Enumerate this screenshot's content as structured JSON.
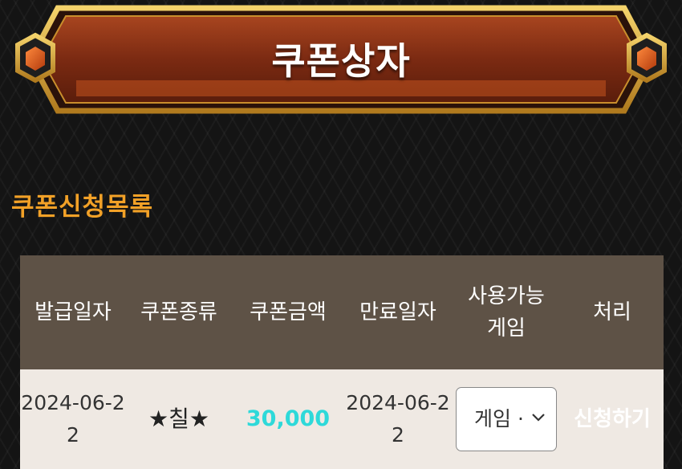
{
  "banner": {
    "title": "쿠폰상자"
  },
  "section": {
    "title": "쿠폰신청목록"
  },
  "table": {
    "headers": [
      "발급일자",
      "쿠폰종류",
      "쿠폰금액",
      "만료일자",
      "사용가능\n게임",
      "처리"
    ],
    "rows": [
      {
        "issue_date": "2024-06-22",
        "coupon_type": "★칠★",
        "amount": "30,000",
        "expiry_date": "2024-06-22",
        "game_select": "게임 ·",
        "action": "신청하기"
      }
    ]
  },
  "colors": {
    "header_bg": "#5e5246",
    "row_bg": "#efe9e3",
    "section_title": "#f2a127",
    "amount": "#2ed9d9",
    "banner_fill": "#8a3217",
    "banner_border": "#d9a63a"
  },
  "icons": [
    "gem-icon-left",
    "gem-icon-right",
    "chevron-down-icon"
  ]
}
